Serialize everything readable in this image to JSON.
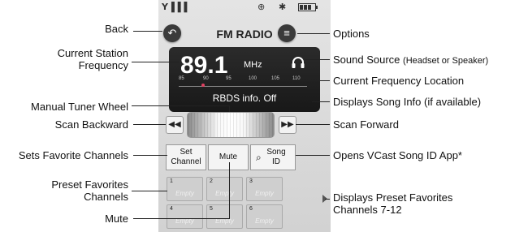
{
  "header": {
    "title": "FM RADIO"
  },
  "display": {
    "frequency": "89.1",
    "unit": "MHz",
    "scale_ticks": [
      "85",
      "90",
      "95",
      "100",
      "105",
      "110"
    ],
    "rbds_status": "RBDS info. Off"
  },
  "controls": {
    "set_channel": "Set Channel",
    "mute": "Mute",
    "song_id": "Song ID"
  },
  "presets": [
    {
      "number": "1",
      "label": "Empty"
    },
    {
      "number": "2",
      "label": "Empty"
    },
    {
      "number": "3",
      "label": "Empty"
    },
    {
      "number": "4",
      "label": "Empty"
    },
    {
      "number": "5",
      "label": "Empty"
    },
    {
      "number": "6",
      "label": "Empty"
    }
  ],
  "callouts": {
    "back": "Back",
    "options": "Options",
    "current_station_frequency": "Current Station Frequency",
    "sound_source": "Sound Source",
    "sound_source_note": "(Headset or Speaker)",
    "current_frequency_location": "Current Frequency Location",
    "manual_tuner_wheel": "Manual Tuner Wheel",
    "displays_song_info": "Displays Song Info (if available)",
    "scan_backward": "Scan Backward",
    "scan_forward": "Scan Forward",
    "sets_favorite_channels": "Sets Favorite Channels",
    "opens_vcast": "Opens VCast Song ID App*",
    "preset_favorites_channels": "Preset Favorites Channels",
    "displays_preset_favorites": "Displays Preset Favorites Channels 7-12",
    "mute": "Mute"
  },
  "icons": [
    "signal-icon",
    "location-icon",
    "bluetooth-icon",
    "battery-icon",
    "back-arrow-icon",
    "options-menu-icon",
    "headset-icon",
    "rewind-icon",
    "fast-forward-icon",
    "search-icon"
  ]
}
